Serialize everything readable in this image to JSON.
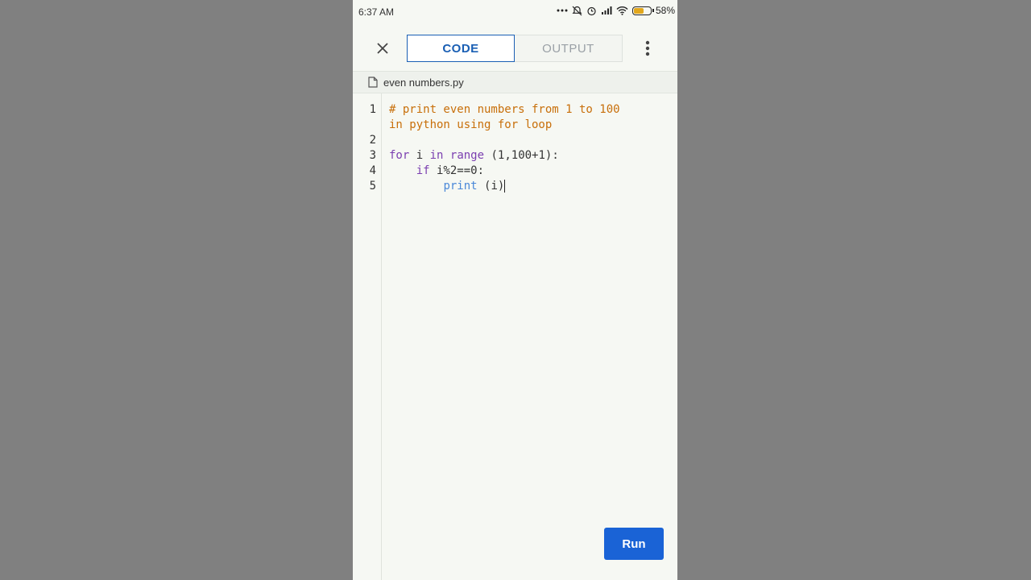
{
  "status": {
    "time": "6:37 AM",
    "battery_percent": "58%",
    "battery_level": 0.58
  },
  "tabs": [
    {
      "label": "CODE",
      "active": true
    },
    {
      "label": "OUTPUT",
      "active": false
    }
  ],
  "file": {
    "name": "even numbers.py"
  },
  "editor": {
    "line_numbers": [
      "1",
      "2",
      "3",
      "4",
      "5"
    ],
    "line1_part1": "# print even numbers from 1 to 100",
    "line1_part2": "in python using for loop",
    "line3_kw_for": "for",
    "line3_var": " i ",
    "line3_kw_in": "in",
    "line3_space": " ",
    "line3_fn": "range",
    "line3_args": " (1,100+1):",
    "line4_indent": "    ",
    "line4_kw_if": "if",
    "line4_cond": " i%2==0:",
    "line5_indent": "        ",
    "line5_fn": "print",
    "line5_args": " (i)"
  },
  "run_label": "Run",
  "colors": {
    "accent": "#1a5fb4",
    "run_button": "#1a63d6",
    "comment": "#c86f0a",
    "keyword": "#7b3fb0",
    "builtin": "#4a88d8"
  }
}
